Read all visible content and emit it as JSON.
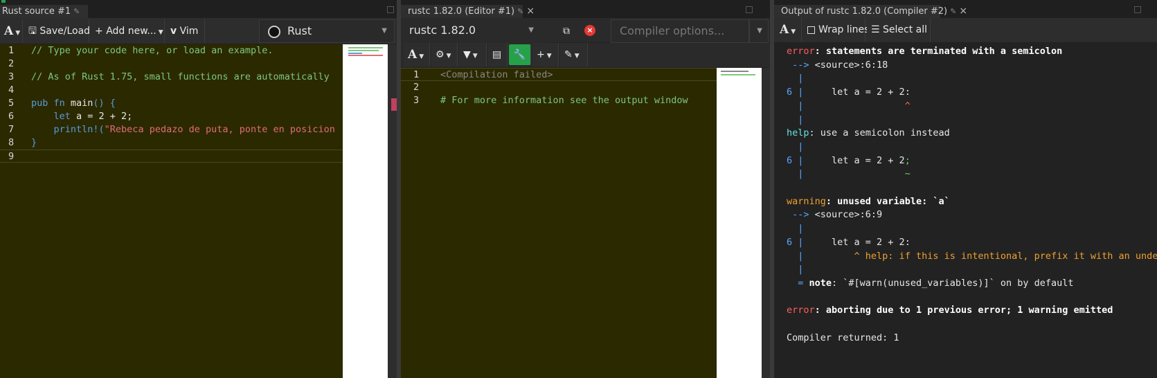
{
  "colors": {
    "editor_bg": "#2b2900",
    "panel_bg": "#222222",
    "accent_green": "#27a04a",
    "error_red": "#ff5f5f"
  },
  "source_pane": {
    "tab_title": "Rust source #1",
    "toolbar": {
      "font_btn": "A",
      "save_load": "Save/Load",
      "add_new": "Add new...",
      "vim": "Vim",
      "language": "Rust"
    },
    "lines": [
      {
        "n": "1",
        "text": "// Type your code here, or load an example."
      },
      {
        "n": "2",
        "text": ""
      },
      {
        "n": "3",
        "text": "// As of Rust 1.75, small functions are automatically"
      },
      {
        "n": "4",
        "text": ""
      },
      {
        "n": "5",
        "kw": "pub fn ",
        "name": "main",
        "rest": "() {"
      },
      {
        "n": "6",
        "kw": "    let ",
        "rest": "a = 2 + 2;"
      },
      {
        "n": "7",
        "mac": "    println!(",
        "str": "\"Rebeca pedazo de puta, ponte en posicion q"
      },
      {
        "n": "8",
        "text": "}"
      },
      {
        "n": "9",
        "text": ""
      }
    ]
  },
  "compiler_pane": {
    "tab_title": "rustc 1.82.0 (Editor #1)",
    "compiler": "rustc 1.82.0",
    "options_placeholder": "Compiler options...",
    "lines": [
      {
        "n": "1",
        "text": "<Compilation failed>"
      },
      {
        "n": "2",
        "text": ""
      },
      {
        "n": "3",
        "text": "# For more information see the output window"
      }
    ]
  },
  "output_pane": {
    "tab_title": "Output of rustc 1.82.0 (Compiler #2)",
    "toolbar": {
      "font_btn": "A",
      "wrap_lines": "Wrap lines",
      "select_all": "Select all"
    },
    "lines": [
      {
        "parts": [
          {
            "c": "red",
            "t": "error"
          },
          {
            "c": "white",
            "t": ": statements are terminated with a semicolon"
          }
        ]
      },
      {
        "parts": [
          {
            "c": "blue",
            "t": " --> "
          },
          {
            "c": "",
            "t": "<source>:6:18"
          }
        ]
      },
      {
        "parts": [
          {
            "c": "blue",
            "t": "  |"
          }
        ]
      },
      {
        "parts": [
          {
            "c": "blue",
            "t": "6 |"
          },
          {
            "c": "",
            "t": "     let a = 2 + 2:"
          }
        ]
      },
      {
        "parts": [
          {
            "c": "blue",
            "t": "  |"
          },
          {
            "c": "red",
            "t": "                  ^"
          }
        ]
      },
      {
        "parts": [
          {
            "c": "blue",
            "t": "  |"
          }
        ]
      },
      {
        "parts": [
          {
            "c": "cyan",
            "t": "help"
          },
          {
            "c": "",
            "t": ": use a semicolon instead"
          }
        ]
      },
      {
        "parts": [
          {
            "c": "blue",
            "t": "  |"
          }
        ]
      },
      {
        "parts": [
          {
            "c": "blue",
            "t": "6 |"
          },
          {
            "c": "",
            "t": "     let a = 2 + 2"
          },
          {
            "c": "grn",
            "t": ";"
          }
        ]
      },
      {
        "parts": [
          {
            "c": "blue",
            "t": "  |"
          },
          {
            "c": "grn",
            "t": "                  ~"
          }
        ]
      },
      {
        "parts": [
          {
            "c": "",
            "t": ""
          }
        ]
      },
      {
        "parts": [
          {
            "c": "yel",
            "t": "warning"
          },
          {
            "c": "white",
            "t": ": unused variable: `a`"
          }
        ]
      },
      {
        "parts": [
          {
            "c": "blue",
            "t": " --> "
          },
          {
            "c": "",
            "t": "<source>:6:9"
          }
        ]
      },
      {
        "parts": [
          {
            "c": "blue",
            "t": "  |"
          }
        ]
      },
      {
        "parts": [
          {
            "c": "blue",
            "t": "6 |"
          },
          {
            "c": "",
            "t": "     let a = 2 + 2:"
          }
        ]
      },
      {
        "parts": [
          {
            "c": "blue",
            "t": "  |"
          },
          {
            "c": "yel",
            "t": "         ^ help: if this is intentional, prefix it with an unders"
          }
        ]
      },
      {
        "parts": [
          {
            "c": "blue",
            "t": "  |"
          }
        ]
      },
      {
        "parts": [
          {
            "c": "blue",
            "t": "  = "
          },
          {
            "c": "white",
            "t": "note"
          },
          {
            "c": "",
            "t": ": `#[warn(unused_variables)]` on by default"
          }
        ]
      },
      {
        "parts": [
          {
            "c": "",
            "t": ""
          }
        ]
      },
      {
        "parts": [
          {
            "c": "red",
            "t": "error"
          },
          {
            "c": "white",
            "t": ": aborting due to 1 previous error; 1 warning emitted"
          }
        ]
      },
      {
        "parts": [
          {
            "c": "",
            "t": ""
          }
        ]
      },
      {
        "parts": [
          {
            "c": "",
            "t": "Compiler returned: 1"
          }
        ]
      }
    ]
  }
}
